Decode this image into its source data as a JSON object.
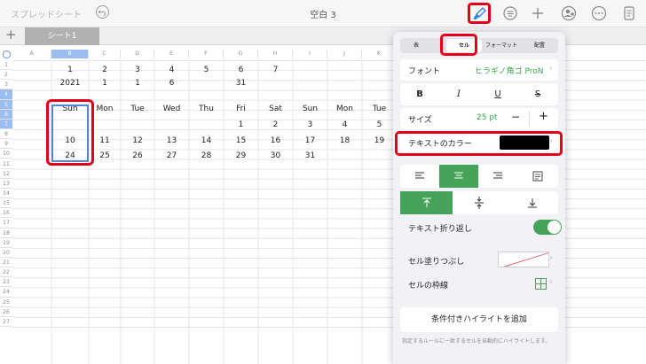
{
  "toolbar": {
    "app_name": "スプレッドシート",
    "doc_title": "空白 3",
    "icons": [
      "undo-icon",
      "paintbrush-icon",
      "list-icon",
      "plus-icon",
      "share-person-icon",
      "more-icon",
      "document-icon"
    ]
  },
  "sheet": {
    "add_label": "+",
    "tab_label": "シート1",
    "columns": [
      "A",
      "B",
      "C",
      "D",
      "E",
      "F",
      "G",
      "H",
      "I",
      "J",
      "K"
    ],
    "rows": [
      "1",
      "2",
      "3",
      "4",
      "5",
      "6",
      "7",
      "8",
      "9",
      "10",
      "11",
      "12",
      "13",
      "14",
      "15",
      "16",
      "17",
      "18",
      "19",
      "20",
      "21",
      "22",
      "23",
      "24",
      "25",
      "26",
      "27"
    ],
    "selected_column": "B",
    "selected_rows": [
      "4",
      "5",
      "6",
      "7"
    ],
    "cells": {
      "r1": [
        "",
        "1",
        "2",
        "3",
        "4",
        "5",
        "6",
        "7",
        "",
        "",
        ""
      ],
      "r2": [
        "",
        "2021",
        "1",
        "1",
        "6",
        "",
        "31",
        "",
        "",
        "",
        ""
      ],
      "r4": [
        "",
        "Sun",
        "Mon",
        "Tue",
        "Wed",
        "Thu",
        "Fri",
        "Sat",
        "Sun",
        "Mon",
        "Tue"
      ],
      "r5": [
        "",
        "",
        "",
        "",
        "",
        "",
        "1",
        "2",
        "3",
        "4",
        "5"
      ],
      "r6": [
        "",
        "10",
        "11",
        "12",
        "13",
        "14",
        "15",
        "16",
        "17",
        "18",
        "19"
      ],
      "r7": [
        "",
        "24",
        "25",
        "26",
        "27",
        "28",
        "29",
        "30",
        "31",
        "",
        ""
      ]
    }
  },
  "format_panel": {
    "tabs": [
      "表",
      "セル",
      "フォーマット",
      "配置"
    ],
    "active_tab": "セル",
    "font_label": "フォント",
    "font_value": "ヒラギノ角ゴ ProN",
    "style_buttons": [
      "B",
      "I",
      "U",
      "S"
    ],
    "size_label": "サイズ",
    "size_value": "25 pt",
    "size_minus": "−",
    "size_plus": "+",
    "text_color_label": "テキストのカラー",
    "text_color_value": "#000000",
    "wrap_label": "テキスト折り返し",
    "wrap_on": true,
    "fill_label": "セル塗りつぶし",
    "border_label": "セルの枠線",
    "conditional_button": "条件付きハイライトを追加",
    "hint_text": "指定するルールに一致するセルを自動的にハイライトします。"
  },
  "colors": {
    "accent_green": "#46a35a",
    "highlight_red": "#e3001b",
    "selection_blue": "#5585d6"
  }
}
